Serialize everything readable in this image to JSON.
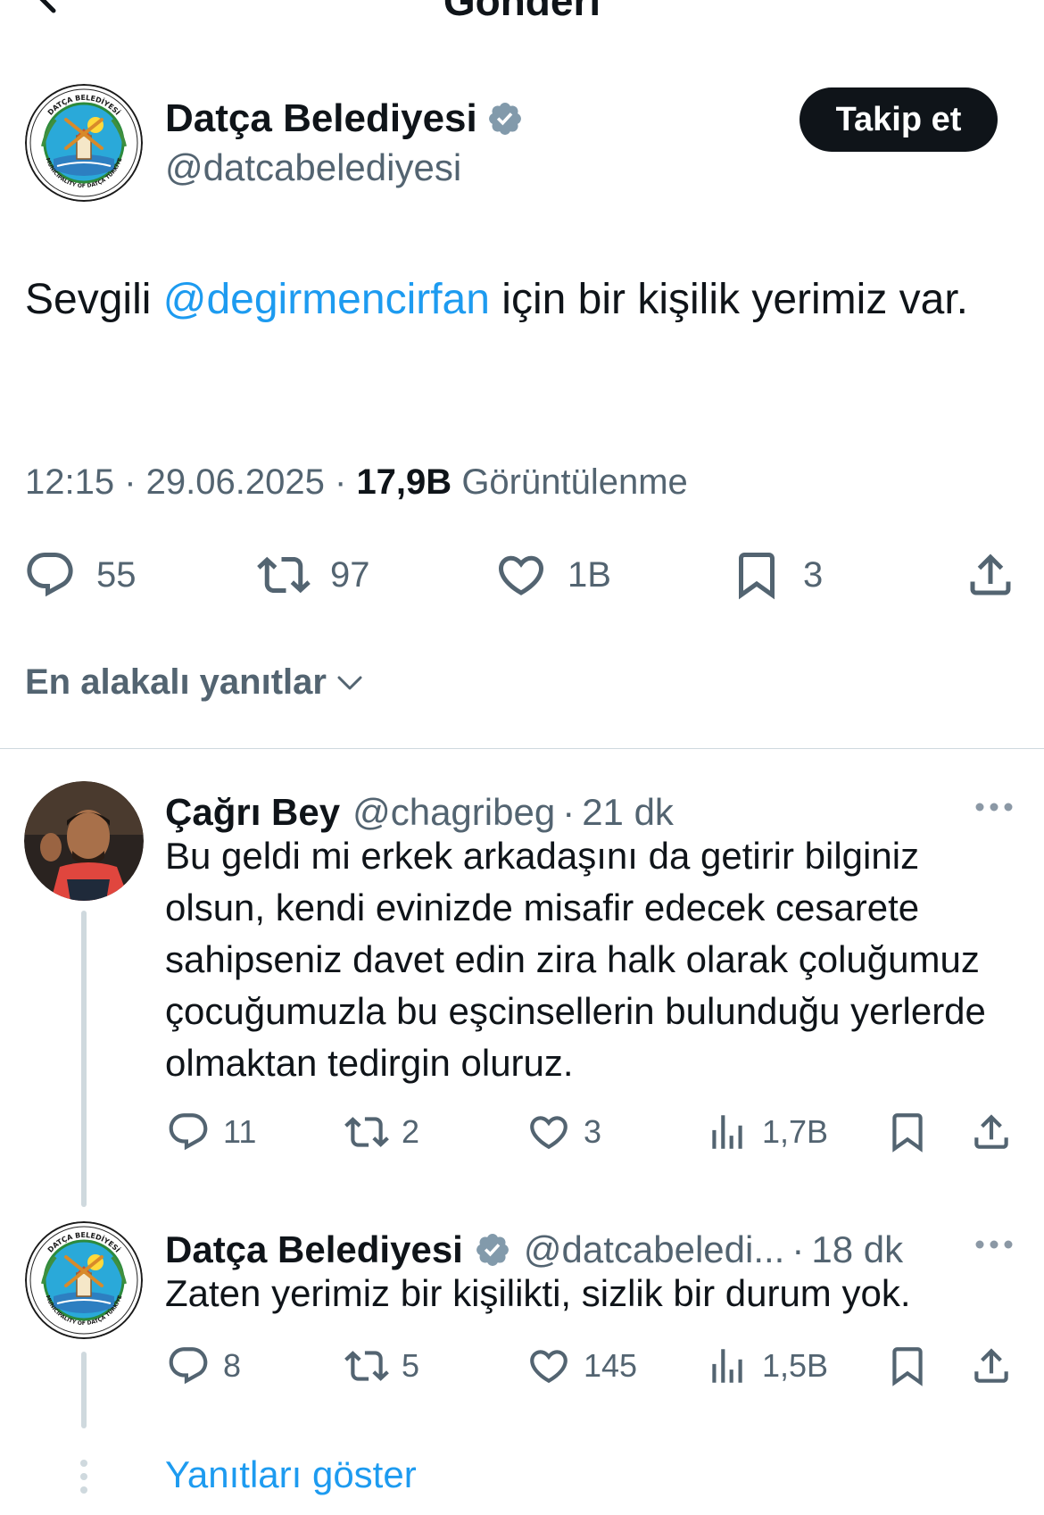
{
  "header": {
    "title": "Gönderi"
  },
  "tweet": {
    "author_name": "Datça Belediyesi",
    "author_handle": "@datcabelediyesi",
    "follow_label": "Takip et",
    "text_before": "Sevgili ",
    "mention": "@degirmencirfan",
    "text_after": " için bir kişilik yerimiz var.",
    "time": "12:15",
    "date": "29.06.2025",
    "views_count": "17,9B",
    "views_label": "Görüntülenme",
    "stats": {
      "replies": "55",
      "reposts": "97",
      "likes": "1B",
      "bookmarks": "3"
    }
  },
  "sort_label": "En alakalı yanıtlar",
  "replies": [
    {
      "name": "Çağrı Bey",
      "handle": "@chagribeg",
      "time": "21 dk",
      "text": "Bu geldi mi erkek arkadaşını da getirir bilginiz olsun, kendi evinizde misafir edecek cesarete sahipseniz davet edin zira halk olarak çoluğumuz çocuğumuzla bu eşcinsellerin bulunduğu yerlerde olmaktan tedirgin oluruz.",
      "stats": {
        "replies": "11",
        "reposts": "2",
        "likes": "3",
        "views": "1,7B"
      }
    },
    {
      "name": "Datça Belediyesi",
      "handle": "@datcabeledi...",
      "time": "18 dk",
      "text": "Zaten yerimiz bir kişilikti, sizlik bir durum yok.",
      "stats": {
        "replies": "8",
        "reposts": "5",
        "likes": "145",
        "views": "1,5B"
      }
    }
  ],
  "show_replies_label": "Yanıtları göster",
  "logo_text": {
    "top": "DATÇA BELEDİYESİ",
    "bottom": "MUNICIPALITY OF DATÇA TÜRKİYE"
  },
  "colors": {
    "accent": "#1d9bf0",
    "text": "#0f1419",
    "secondary": "#536471",
    "button_bg": "#0f1419",
    "divider": "#cfd9de"
  },
  "icons": [
    "back-arrow-icon",
    "verified-badge-icon",
    "reply-icon",
    "repost-icon",
    "like-icon",
    "bookmark-icon",
    "share-icon",
    "views-icon",
    "chevron-down-icon",
    "more-icon"
  ]
}
